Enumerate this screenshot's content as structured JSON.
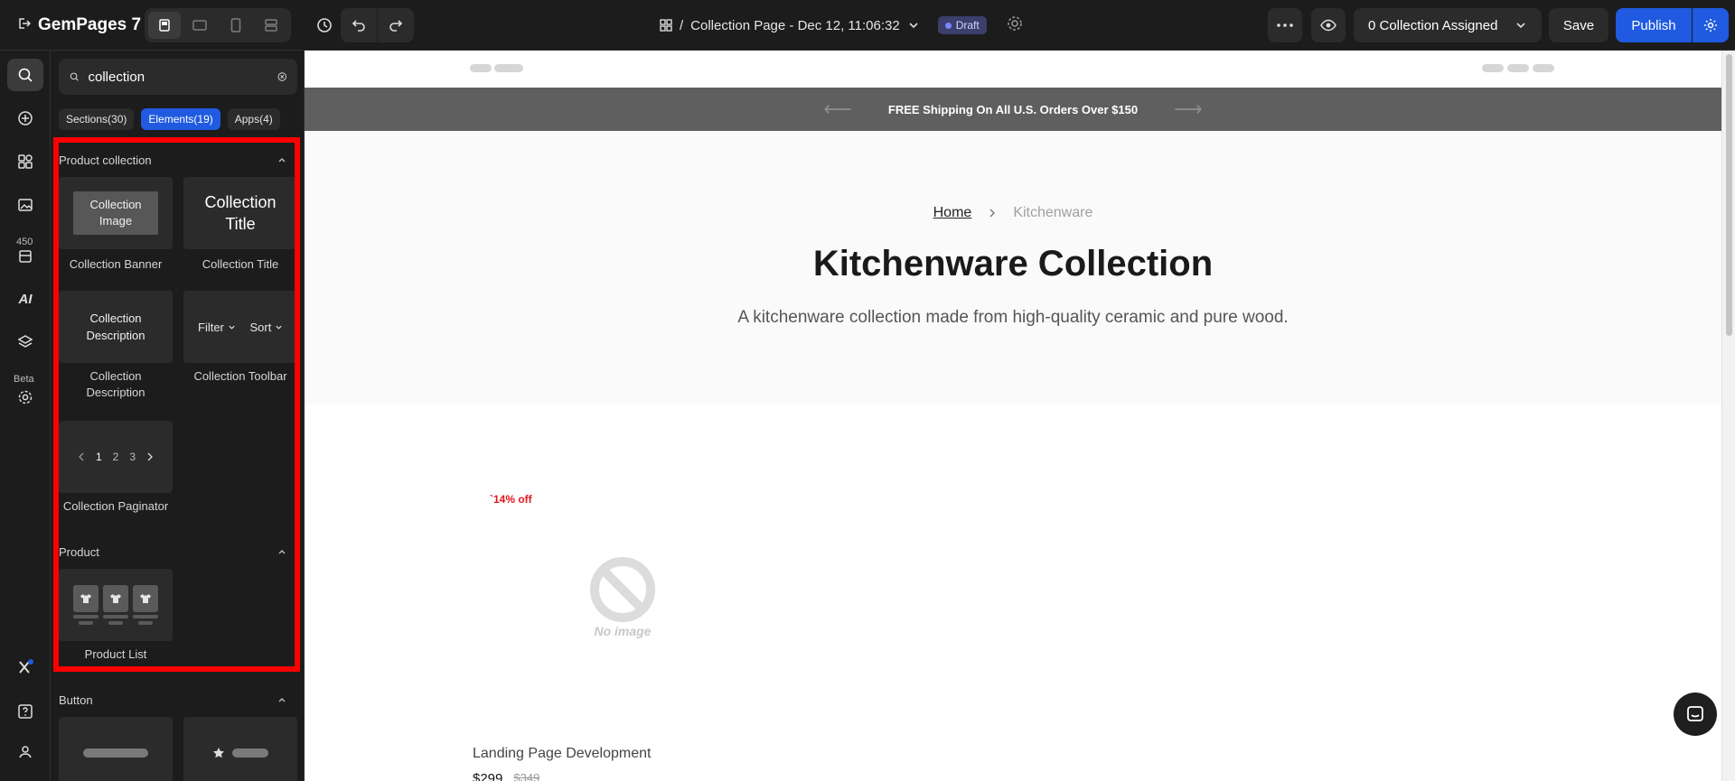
{
  "topbar": {
    "brand": "GemPages 7",
    "page_title_prefix": "/",
    "page_title": "Collection Page - Dec 12, 11:06:32",
    "status": "Draft",
    "assign_label": "0 Collection Assigned",
    "save_label": "Save",
    "publish_label": "Publish"
  },
  "rail": {
    "badge_count": "450",
    "ai_label": "AI",
    "beta_label": "Beta"
  },
  "panel": {
    "search_value": "collection",
    "filters": [
      "Sections(30)",
      "Elements(19)",
      "Apps(4)"
    ],
    "groups": {
      "product_collection": "Product collection",
      "product": "Product",
      "button": "Button"
    },
    "cards": {
      "banner_preview": "Collection Image",
      "banner_label": "Collection Banner",
      "title_preview": "Collection Title",
      "title_label": "Collection Title",
      "desc_preview": "Collection Description",
      "desc_label": "Collection Description",
      "toolbar_filter": "Filter",
      "toolbar_sort": "Sort",
      "toolbar_label": "Collection Toolbar",
      "paginator_pages": [
        "1",
        "2",
        "3"
      ],
      "paginator_label": "Collection Paginator",
      "product_list_label": "Product List"
    }
  },
  "canvas": {
    "announcement": "FREE Shipping On All U.S. Orders Over $150",
    "breadcrumb_home": "Home",
    "breadcrumb_current": "Kitchenware",
    "title": "Kitchenware Collection",
    "description": "A kitchenware collection made from high-quality ceramic and pure wood.",
    "sale_badge": "`14% off",
    "no_image_label": "No image",
    "product_name": "Landing Page Development",
    "product_price": "$299",
    "product_compare_price": "$349"
  }
}
